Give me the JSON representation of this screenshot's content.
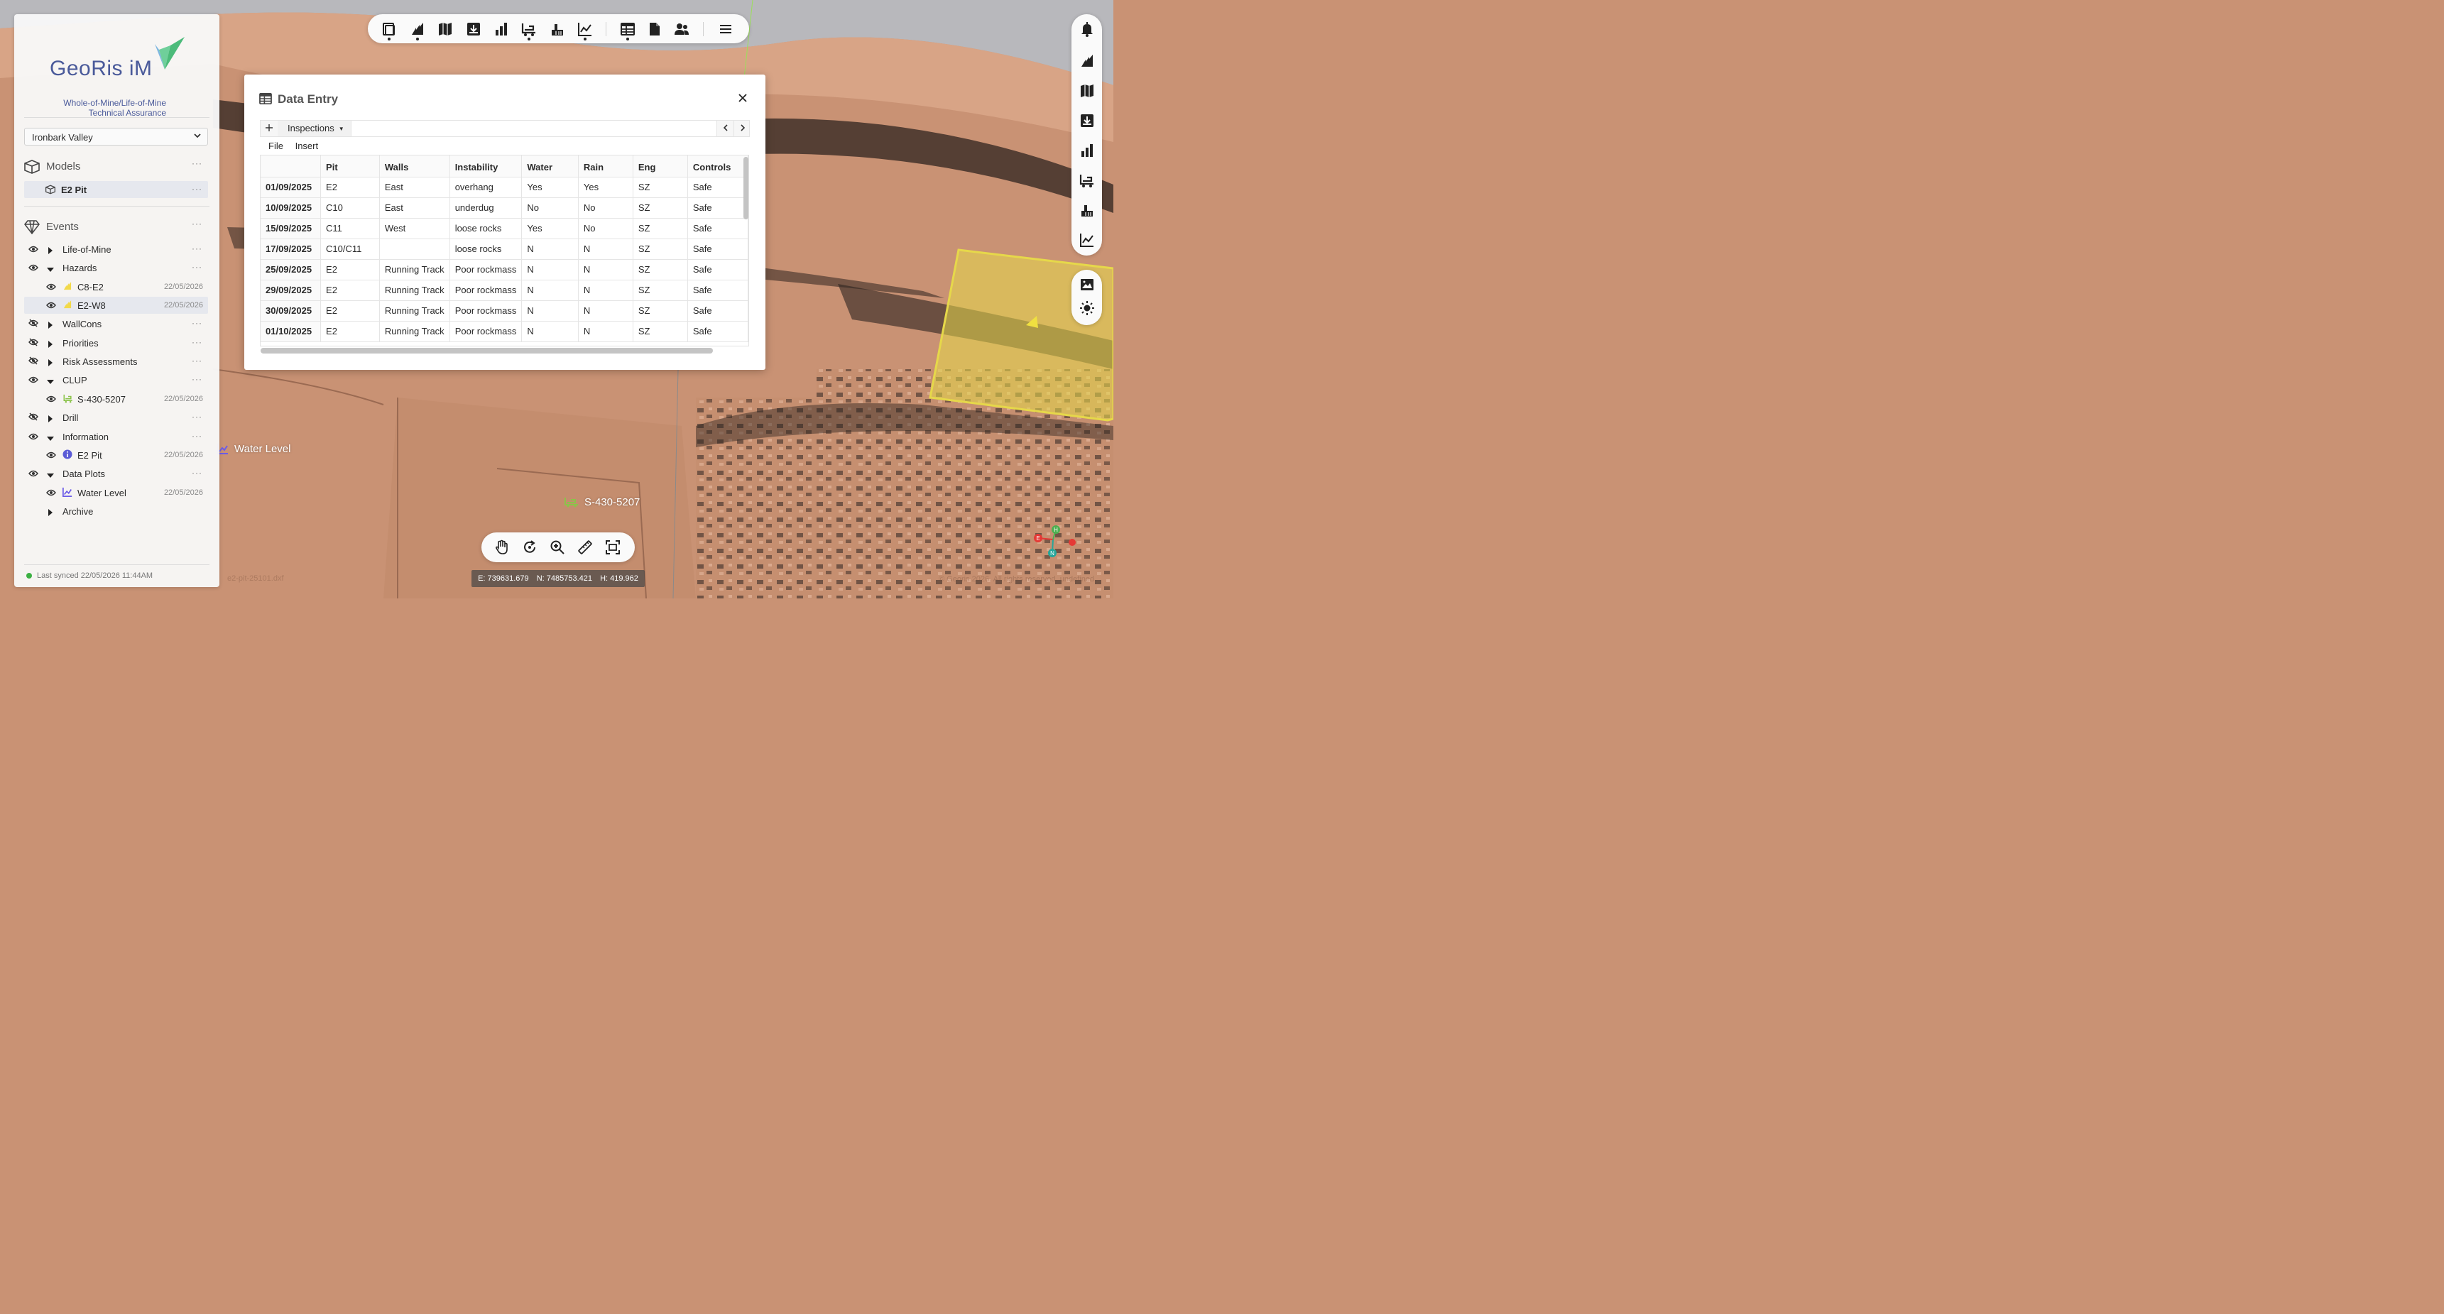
{
  "app": {
    "name": "GeoRis iM",
    "tagline_line1": "Whole-of-Mine/Life-of-Mine",
    "tagline_line2": "Technical Assurance",
    "site": "Ironbark Valley",
    "sync_status": "Last synced 22/05/2026 11:44AM"
  },
  "models": {
    "title": "Models",
    "items": [
      {
        "label": "E2 Pit"
      }
    ]
  },
  "events": {
    "title": "Events",
    "items": [
      {
        "label": "Life-of-Mine",
        "visible": true,
        "expanded": false
      },
      {
        "label": "Hazards",
        "visible": true,
        "expanded": true
      },
      {
        "label": "C8-E2",
        "date": "22/05/2026",
        "icon": "hazard-icon"
      },
      {
        "label": "E2-W8",
        "date": "22/05/2026",
        "icon": "hazard-icon",
        "selected": true
      },
      {
        "label": "WallCons",
        "visible": false,
        "expanded": false
      },
      {
        "label": "Priorities",
        "visible": false,
        "expanded": false
      },
      {
        "label": "Risk Assessments",
        "visible": false,
        "expanded": false
      },
      {
        "label": "CLUP",
        "visible": true,
        "expanded": true
      },
      {
        "label": "S-430-5207",
        "date": "22/05/2026",
        "icon": "excavator-icon"
      },
      {
        "label": "Drill",
        "visible": false,
        "expanded": false
      },
      {
        "label": "Information",
        "visible": true,
        "expanded": true
      },
      {
        "label": "E2 Pit",
        "date": "22/05/2026",
        "icon": "info-icon"
      },
      {
        "label": "Data Plots",
        "visible": true,
        "expanded": true
      },
      {
        "label": "Water Level",
        "date": "22/05/2026",
        "icon": "line-chart-icon"
      },
      {
        "label": "Archive",
        "expanded": false
      }
    ]
  },
  "modal": {
    "title": "Data Entry",
    "sheet_tab": "Inspections",
    "menu": [
      "File",
      "Insert"
    ],
    "columns": [
      "",
      "Pit",
      "Walls",
      "Instability",
      "Water",
      "Rain",
      "Eng",
      "Controls"
    ],
    "rows": [
      [
        "01/09/2025",
        "E2",
        "East",
        "overhang",
        "Yes",
        "Yes",
        "SZ",
        "Safe"
      ],
      [
        "10/09/2025",
        "C10",
        "East",
        "underdug",
        "No",
        "No",
        "SZ",
        "Safe"
      ],
      [
        "15/09/2025",
        "C11",
        "West",
        "loose rocks",
        "Yes",
        "No",
        "SZ",
        "Safe"
      ],
      [
        "17/09/2025",
        "C10/C11",
        "",
        "loose rocks",
        "N",
        "N",
        "SZ",
        "Safe"
      ],
      [
        "25/09/2025",
        "E2",
        "Running Track",
        "Poor rockmass",
        "N",
        "N",
        "SZ",
        "Safe"
      ],
      [
        "29/09/2025",
        "E2",
        "Running Track",
        "Poor rockmass",
        "N",
        "N",
        "SZ",
        "Safe"
      ],
      [
        "30/09/2025",
        "E2",
        "Running Track",
        "Poor rockmass",
        "N",
        "N",
        "SZ",
        "Safe"
      ],
      [
        "01/10/2025",
        "E2",
        "Running Track",
        "Poor rockmass",
        "N",
        "N",
        "SZ",
        "Safe"
      ]
    ]
  },
  "map": {
    "labels": {
      "water_level": "Water Level",
      "survey": "S-430-5207"
    },
    "coords": {
      "e": "E: 739631.679",
      "n": "N: 7485753.421",
      "h": "H: 419.962"
    },
    "file_label": "e2-pit-25101.dxf",
    "copyright": "© Georis 2026. All rights reserved. undefined",
    "axis": {
      "e": "E",
      "h": "H",
      "n": "N"
    }
  },
  "colors": {
    "accent": "#4a5a9a",
    "terrain": "#c99274",
    "hazard_zone": "#e6d84a",
    "sync_ok": "#3cb043"
  },
  "toolbar_icons": [
    "layers-icon",
    "hazard-icon",
    "map-icon",
    "download-box-icon",
    "bar-chart-icon",
    "excavator-icon",
    "drill-icon",
    "line-chart-icon",
    "table-icon",
    "document-icon",
    "users-icon",
    "menu-icon"
  ],
  "right_icons": [
    "bell-icon",
    "hazard-icon",
    "map-icon",
    "download-box-icon",
    "bar-chart-icon",
    "excavator-icon",
    "drill-icon",
    "line-chart-icon",
    "image-icon",
    "sun-icon"
  ],
  "nav_icons": [
    "pan-hand-icon",
    "rotate-icon",
    "zoom-icon",
    "measure-ruler-icon",
    "fit-extent-icon"
  ]
}
